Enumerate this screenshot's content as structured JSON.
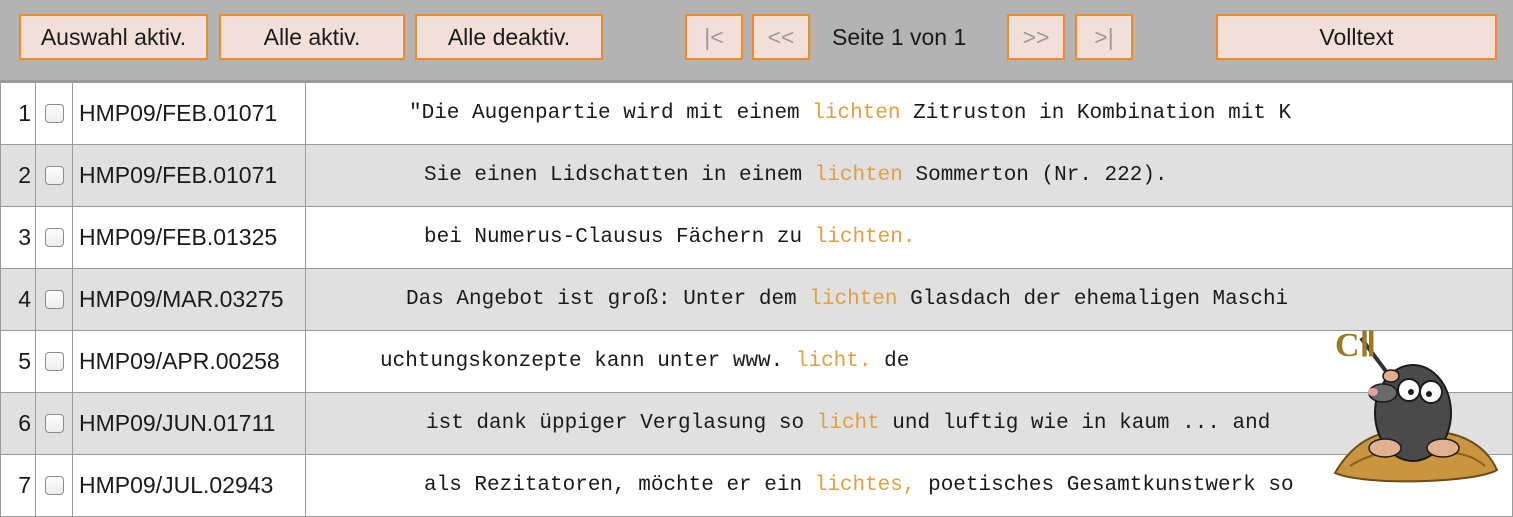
{
  "toolbar": {
    "select_active": "Auswahl aktiv.",
    "all_active": "Alle aktiv.",
    "all_deactivate": "Alle deaktiv.",
    "first_page": "|<",
    "prev_page": "<<",
    "page_info": "Seite 1 von 1",
    "next_page": ">>",
    "last_page": ">|",
    "fulltext": "Volltext"
  },
  "rows": [
    {
      "num": "1",
      "sigle": "HMP09/FEB.01071",
      "left": "\"Die Augenpartie wird mit einem ",
      "kw": "lichten",
      "right": " Zitruston in Kombination mit K"
    },
    {
      "num": "2",
      "sigle": "HMP09/FEB.01071",
      "left": "Sie einen Lidschatten in einem ",
      "kw": "lichten",
      "right": " Sommerton (Nr. 222)."
    },
    {
      "num": "3",
      "sigle": "HMP09/FEB.01325",
      "left": "bei Numerus-Clausus Fächern zu ",
      "kw": "lichten.",
      "right": ""
    },
    {
      "num": "4",
      "sigle": "HMP09/MAR.03275",
      "left": "Das Angebot ist groß: Unter dem ",
      "kw": "lichten",
      "right": " Glasdach der ehemaligen Maschi"
    },
    {
      "num": "5",
      "sigle": "HMP09/APR.00258",
      "left": "uchtungskonzepte kann unter www. ",
      "kw": "licht.",
      "right": " de"
    },
    {
      "num": "6",
      "sigle": "HMP09/JUN.01711",
      "left": "ist dank üppiger Verglasung so ",
      "kw": "licht",
      "right": " und luftig wie in kaum ... and"
    },
    {
      "num": "7",
      "sigle": "HMP09/JUL.02943",
      "left": "als Rezitatoren, möchte er ein ",
      "kw": "lichtes,",
      "right": " poetisches Gesamtkunstwerk so"
    }
  ],
  "mascot_text": "CⅡ",
  "colors": {
    "toolbar_bg": "#b3b3b3",
    "button_bg": "#f3dfda",
    "button_border": "#f08a24",
    "keyword": "#e0a040",
    "row_alt": "#e0e0e0"
  }
}
